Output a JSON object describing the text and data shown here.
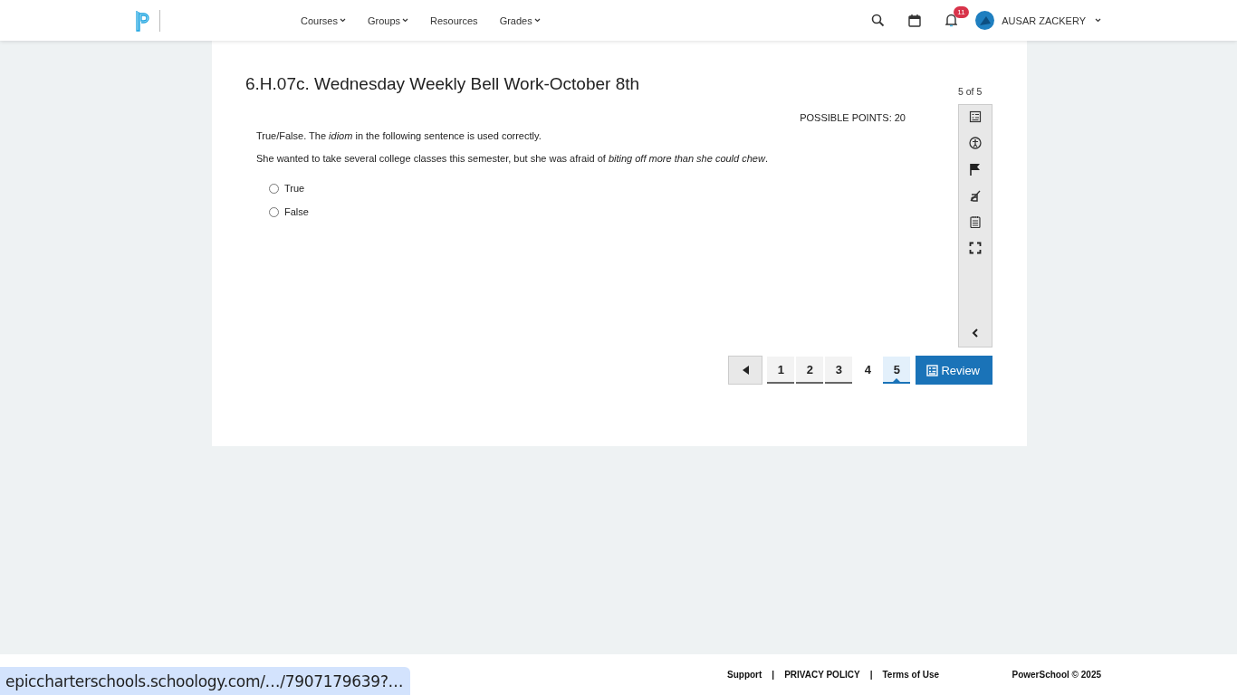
{
  "header": {
    "nav": [
      {
        "label": "Courses",
        "dropdown": true
      },
      {
        "label": "Groups",
        "dropdown": true
      },
      {
        "label": "Resources",
        "dropdown": false
      },
      {
        "label": "Grades",
        "dropdown": true
      }
    ],
    "notification_count": "11",
    "user": "AUSAR ZACKERY"
  },
  "assessment": {
    "title": "6.H.07c. Wednesday Weekly Bell Work-October 8th",
    "position": "5 of 5",
    "points": "POSSIBLE POINTS: 20",
    "prompt": "True/False. The *idiom* in the following sentence is used correctly.",
    "sentence": "She wanted to take several college classes this semester, but she was afraid of *biting off more than she could chew*.",
    "answers": [
      {
        "label": "True",
        "selected": false
      },
      {
        "label": "False",
        "selected": false
      }
    ],
    "pages": [
      {
        "label": "1",
        "answered": true,
        "selected": false
      },
      {
        "label": "2",
        "answered": true,
        "selected": false
      },
      {
        "label": "3",
        "answered": true,
        "selected": false
      },
      {
        "label": "4",
        "answered": false,
        "selected": false
      },
      {
        "label": "5",
        "answered": false,
        "selected": true
      }
    ],
    "review_button": "Review"
  },
  "footer": {
    "links": [
      {
        "kind": "link",
        "label": "Support"
      },
      {
        "kind": "separator",
        "label": "|"
      },
      {
        "kind": "link",
        "label": "PRIVACY POLICY"
      },
      {
        "kind": "separator",
        "label": "|"
      },
      {
        "kind": "link",
        "label": "Terms of Use"
      }
    ],
    "copyright": "PowerSchool © 2025"
  },
  "status_url": "epiccharterschools.schoology.com/…/7907179639?…"
}
